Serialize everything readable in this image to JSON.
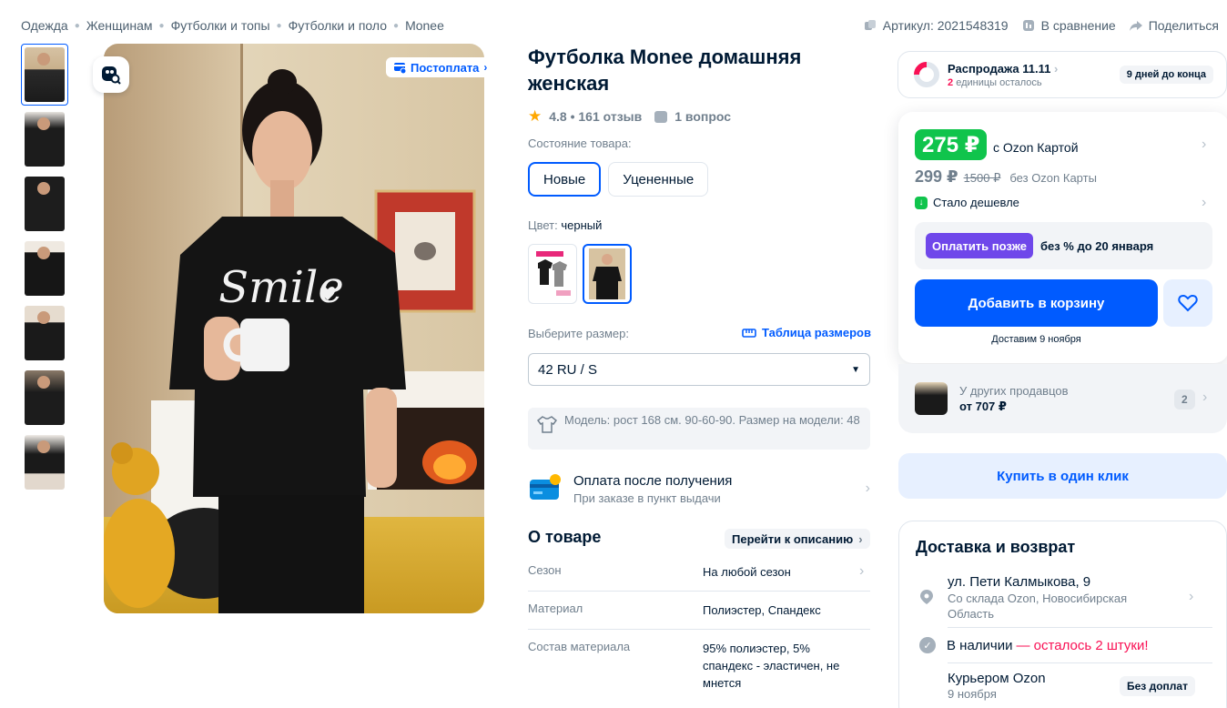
{
  "breadcrumb": [
    "Одежда",
    "Женщинам",
    "Футболки и топы",
    "Футболки и поло",
    "Monee"
  ],
  "top_actions": {
    "article": "Артикул: 2021548319",
    "compare": "В сравнение",
    "share": "Поделиться"
  },
  "gallery": {
    "badge": "Постоплата",
    "thumbnail_count": 7,
    "shirt_text": "Smile"
  },
  "product": {
    "title": "Футболка Monee домашняя женская",
    "rating": "4.8 • 161 отзыв",
    "questions": "1 вопрос",
    "condition_label": "Состояние товара:",
    "condition_options": [
      "Новые",
      "Уцененные"
    ],
    "color_label": "Цвет:",
    "color_value": "черный",
    "size_label": "Выберите размер:",
    "size_table": "Таблица размеров",
    "size_selected": "42 RU / S",
    "model_info": "Модель: рост 168 см. 90-60-90. Размер на модели: 48",
    "pay_after_title": "Оплата после получения",
    "pay_after_sub": "При заказе в пункт выдачи",
    "about_title": "О товаре",
    "about_link": "Перейти к описанию",
    "specs": [
      {
        "key": "Сезон",
        "value": "На любой сезон"
      },
      {
        "key": "Материал",
        "value": "Полиэстер, Спандекс"
      },
      {
        "key": "Состав материала",
        "value": "95% полиэстер, 5% спандекс - эластичен, не мнется"
      }
    ]
  },
  "sale": {
    "title": "Распродажа 11.11",
    "remaining_count": "2",
    "remaining_text": "единицы осталось",
    "days": "9 дней до конца"
  },
  "price": {
    "card_price": "275 ₽",
    "card_label": "с Ozon Картой",
    "price": "299 ₽",
    "old_price": "1500 ₽",
    "no_card_label": "без Ozon Карты",
    "cheaper": "Стало дешевле",
    "pay_later_btn": "Оплатить позже",
    "pay_later_text": "без % до 20 января",
    "add_to_cart": "Добавить в корзину",
    "delivery_date": "Доставим 9 ноября"
  },
  "other_sellers": {
    "title": "У других продавцов",
    "price": "от 707 ₽",
    "count": "2"
  },
  "one_click": "Купить в один клик",
  "delivery": {
    "title": "Доставка и возврат",
    "address": "ул. Пети Калмыкова, 9",
    "warehouse": "Со склада Ozon, Новосибирская Область",
    "stock_label": "В наличии",
    "stock_left": "— осталось 2 штуки!",
    "courier": "Курьером Ozon",
    "courier_date": "9 ноября",
    "courier_badge": "Без доплат"
  },
  "colors": {
    "accent": "#005bff",
    "green": "#10c44c",
    "purple": "#6f47ea",
    "pink": "#f91155",
    "text": "#001a34",
    "muted": "#707f8d"
  }
}
